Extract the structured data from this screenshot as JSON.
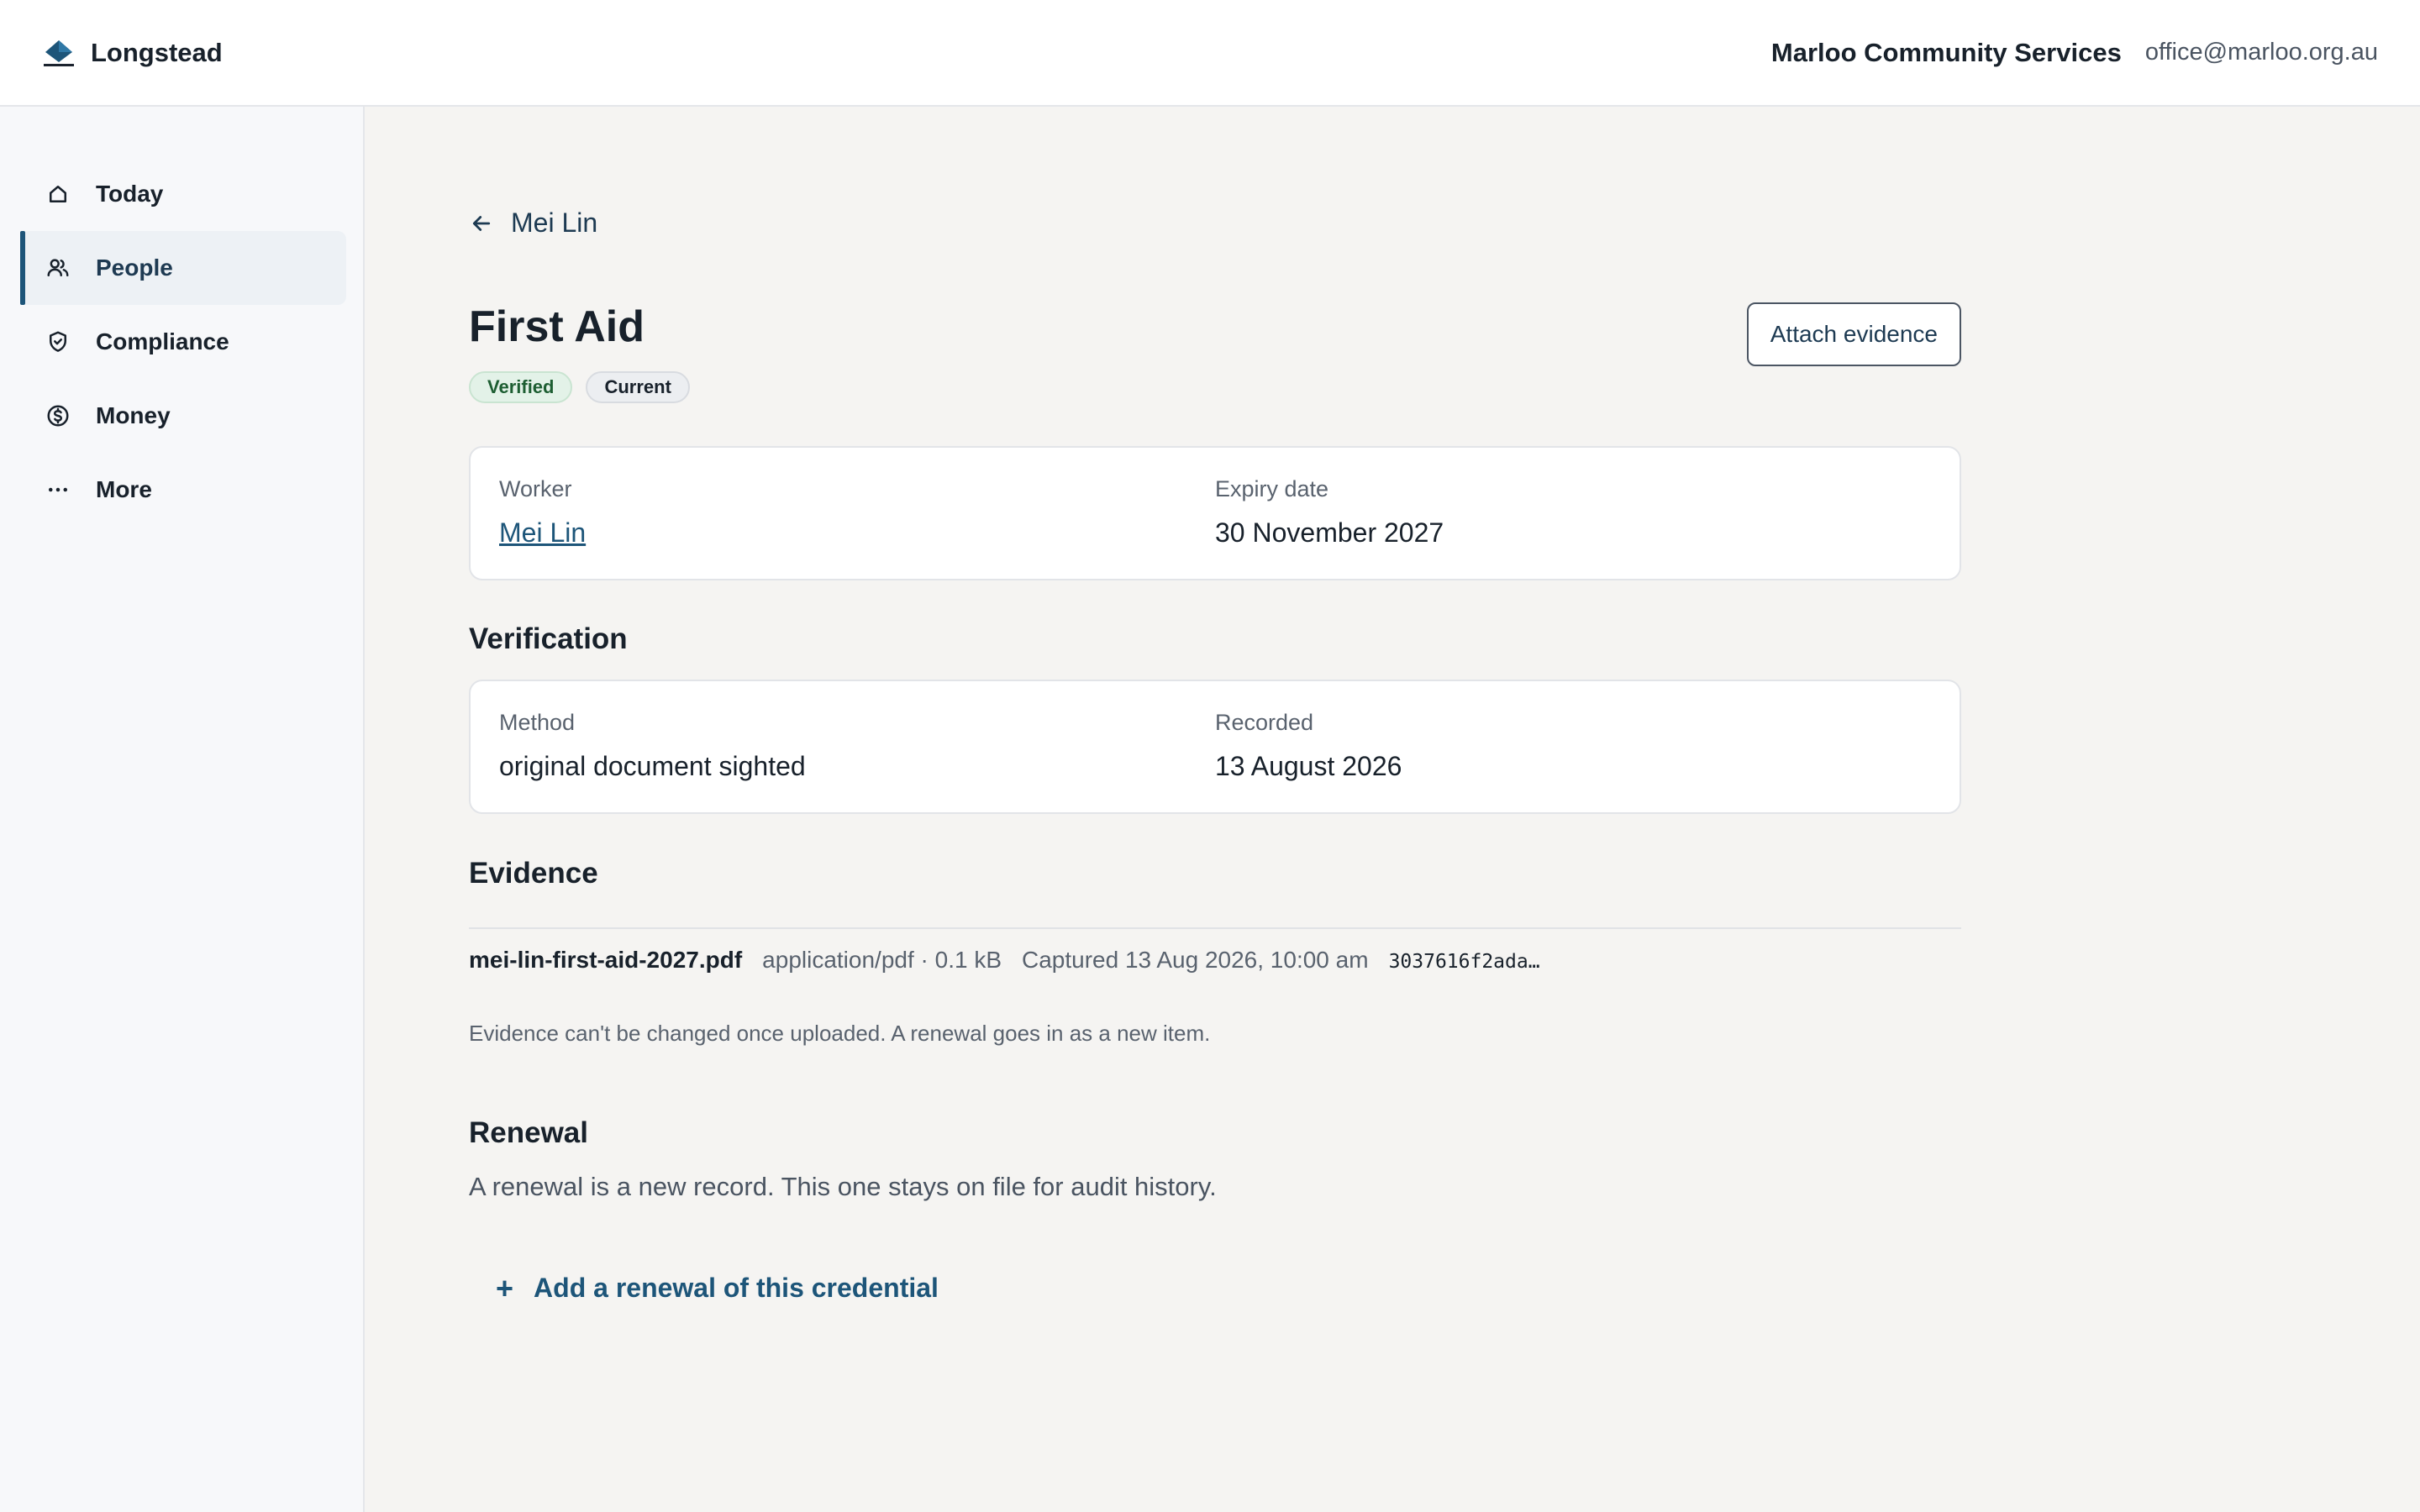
{
  "app": {
    "name": "Longstead"
  },
  "org": {
    "name": "Marloo Community Services",
    "email": "office@marloo.org.au"
  },
  "sidebar": {
    "items": [
      {
        "label": "Today",
        "icon": "home-icon"
      },
      {
        "label": "People",
        "icon": "people-icon",
        "active": true
      },
      {
        "label": "Compliance",
        "icon": "shield-check-icon"
      },
      {
        "label": "Money",
        "icon": "dollar-circle-icon"
      },
      {
        "label": "More",
        "icon": "ellipsis-icon"
      }
    ]
  },
  "page": {
    "back_label": "Mei Lin",
    "title": "First Aid",
    "badges": {
      "verified": "Verified",
      "current": "Current"
    },
    "attach_label": "Attach evidence",
    "details": {
      "worker_label": "Worker",
      "worker_value": "Mei Lin",
      "expiry_label": "Expiry date",
      "expiry_value": "30 November 2027"
    },
    "verification": {
      "title": "Verification",
      "method_label": "Method",
      "method_value": "original document sighted",
      "recorded_label": "Recorded",
      "recorded_value": "13 August 2026"
    },
    "evidence": {
      "title": "Evidence",
      "file_name": "mei-lin-first-aid-2027.pdf",
      "file_type": "application/pdf · 0.1 kB",
      "captured": "Captured 13 Aug 2026, 10:00 am",
      "hash": "3037616f2ada…",
      "note": "Evidence can't be changed once uploaded. A renewal goes in as a new item."
    },
    "renewal": {
      "title": "Renewal",
      "text": "A renewal is a new record. This one stays on file for audit history.",
      "add_label": "Add a renewal of this credential"
    }
  },
  "colors": {
    "accent": "#1d5579",
    "verified_bg": "#e3f2e8",
    "verified_text": "#1d5e32"
  }
}
